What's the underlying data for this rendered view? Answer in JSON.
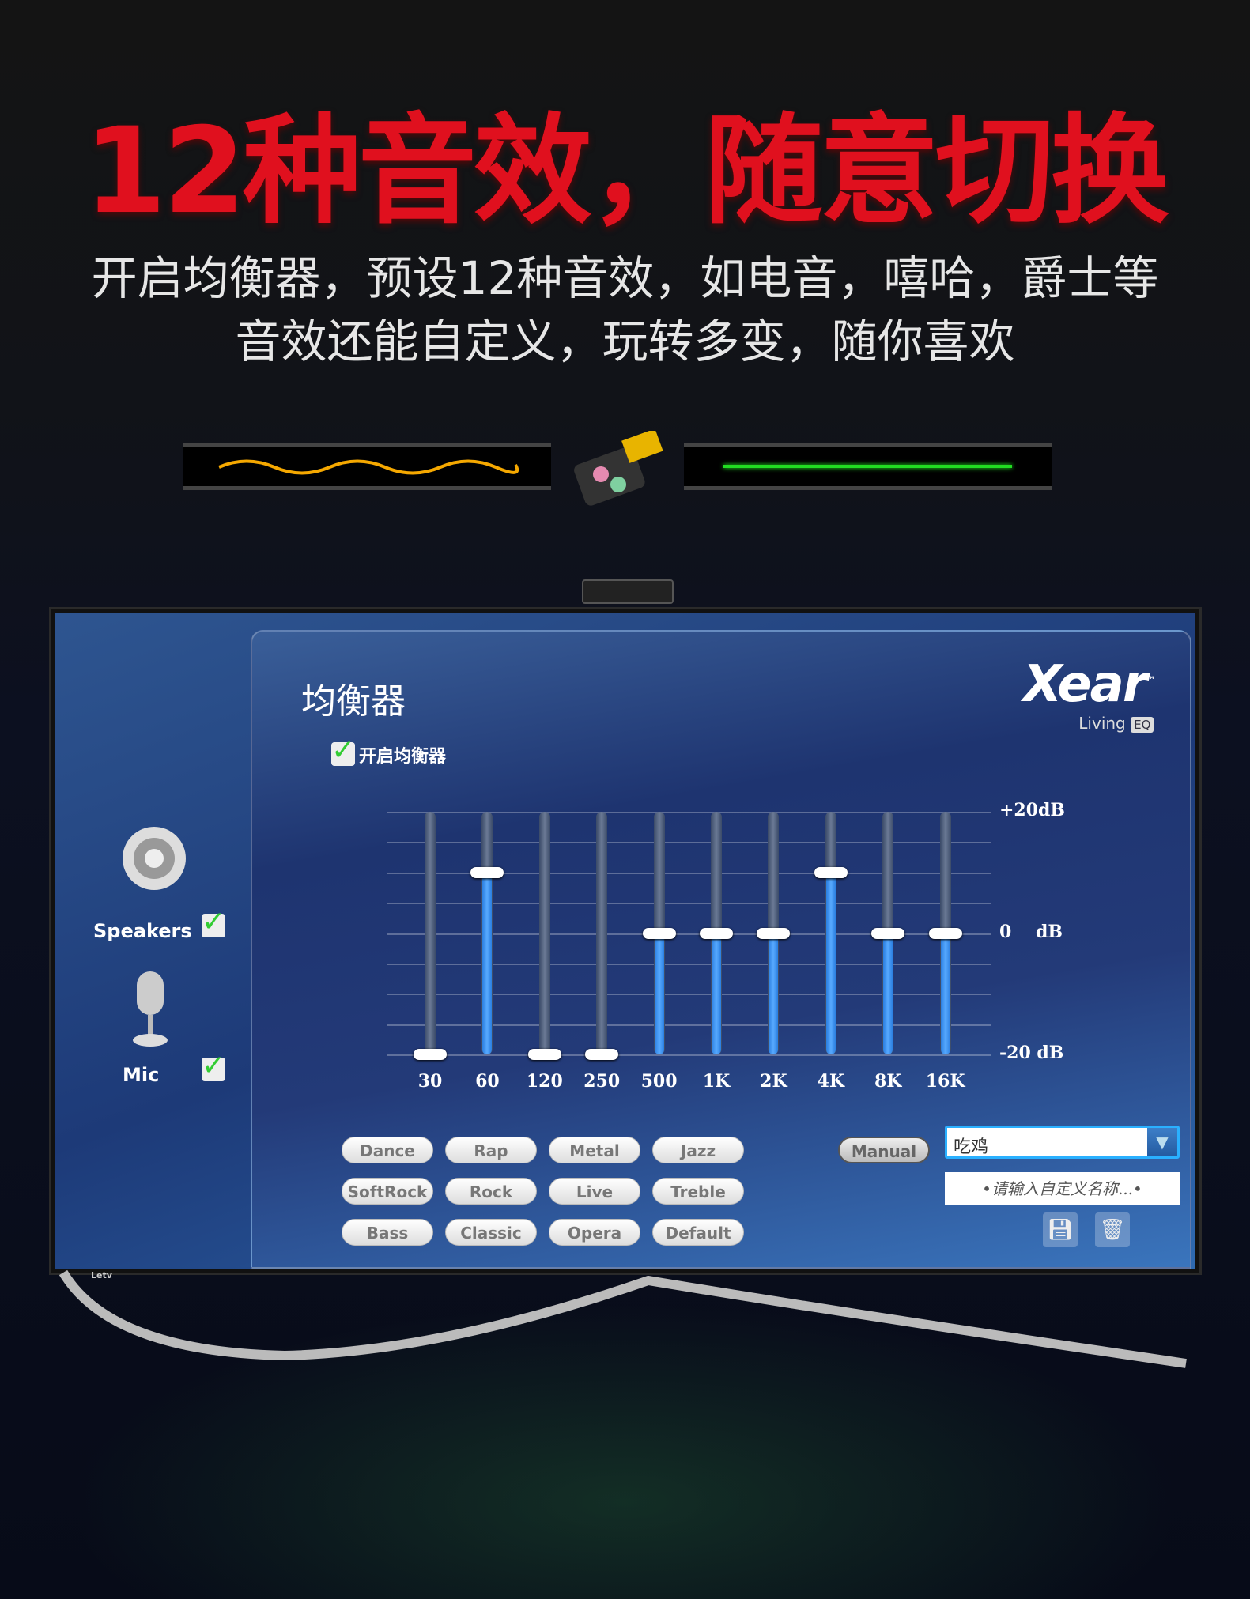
{
  "headline": "12种音效，随意切换",
  "subtitle": [
    "开启均衡器，预设12种音效，如电音，嘻哈，爵士等",
    "音效还能自定义，玩转多变，随你喜欢"
  ],
  "colors": {
    "headline": "#e0101e",
    "slider_fill": "#3a8ff0",
    "wave_left": "#f5a800",
    "wave_right": "#22dd22"
  },
  "tv_brand": "Letv",
  "sidebar": {
    "items": [
      {
        "label": "Speakers",
        "icon": "speaker-icon",
        "checked": true
      },
      {
        "label": "Mic",
        "icon": "microphone-icon",
        "checked": true
      }
    ]
  },
  "panel": {
    "title": "均衡器",
    "logo": {
      "text": "Xear",
      "tm": "™",
      "sub": "Living",
      "badge": "EQ"
    },
    "enable_label": "开启均衡器",
    "enable_checked": true
  },
  "chart_data": {
    "type": "bar",
    "categories": [
      "30",
      "60",
      "120",
      "250",
      "500",
      "1K",
      "2K",
      "4K",
      "8K",
      "16K"
    ],
    "values": [
      -20,
      10,
      -20,
      -20,
      0,
      0,
      0,
      10,
      0,
      0
    ],
    "ylim": [
      -20,
      20
    ],
    "ytick_labels": [
      "+20dB",
      "0    dB",
      "-20 dB"
    ],
    "grid": true
  },
  "presets": [
    "Dance",
    "Rap",
    "Metal",
    "Jazz",
    "SoftRock",
    "Rock",
    "Live",
    "Treble",
    "Bass",
    "Classic",
    "Opera",
    "Default"
  ],
  "manual_label": "Manual",
  "preset_select": {
    "value": "吃鸡"
  },
  "name_input": {
    "placeholder": "•请输入自定义名称...•"
  }
}
